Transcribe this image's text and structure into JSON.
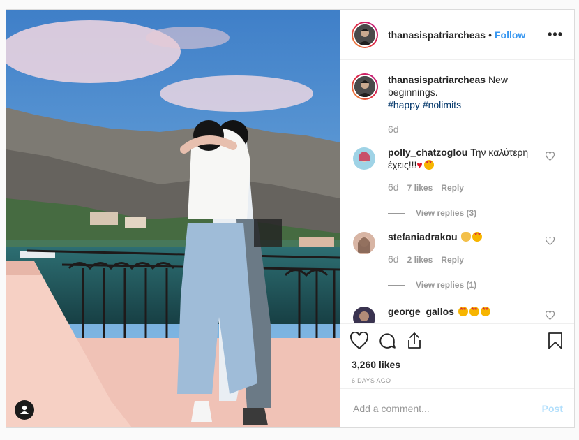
{
  "post": {
    "username": "thanasispatriarcheas",
    "separator": "•",
    "follow_label": "Follow",
    "more_label": "•••",
    "caption": {
      "username": "thanasispatriarcheas",
      "text": "New beginnings.",
      "hashtags": [
        "#happy",
        "#nolimits"
      ],
      "time": "6d"
    },
    "comments": [
      {
        "username": "polly_chatzoglou",
        "text": "Την καλύτερη έχεις!!!",
        "emojis": [
          "red-heart",
          "star-struck"
        ],
        "time": "6d",
        "likes": "7 likes",
        "reply_label": "Reply",
        "view_replies": "View replies (3)"
      },
      {
        "username": "stefaniadrakou",
        "text": "",
        "emojis": [
          "clapping-hands",
          "star-struck"
        ],
        "time": "6d",
        "likes": "2 likes",
        "reply_label": "Reply",
        "view_replies": "View replies (1)"
      },
      {
        "username": "george_gallos",
        "text": "",
        "emojis": [
          "star-struck",
          "star-struck",
          "star-struck"
        ]
      }
    ],
    "likes_count": "3,260 likes",
    "time_ago": "6 DAYS AGO",
    "add_comment_placeholder": "Add a comment...",
    "post_label": "Post"
  }
}
